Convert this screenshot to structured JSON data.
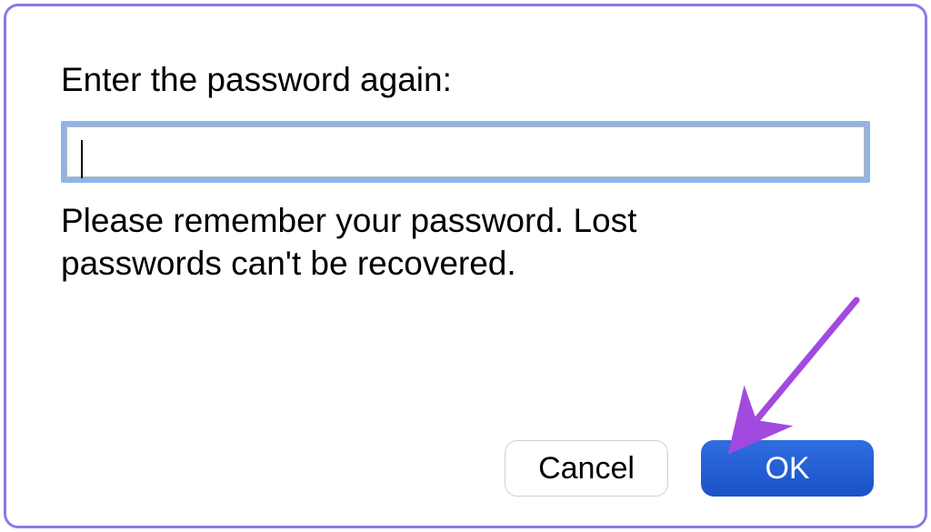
{
  "dialog": {
    "prompt": "Enter the password again:",
    "password_value": "",
    "warning": "Please remember your password. Lost passwords can't be recovered."
  },
  "buttons": {
    "cancel": "Cancel",
    "ok": "OK"
  },
  "annotation": {
    "arrow_color": "#a24ae0"
  }
}
